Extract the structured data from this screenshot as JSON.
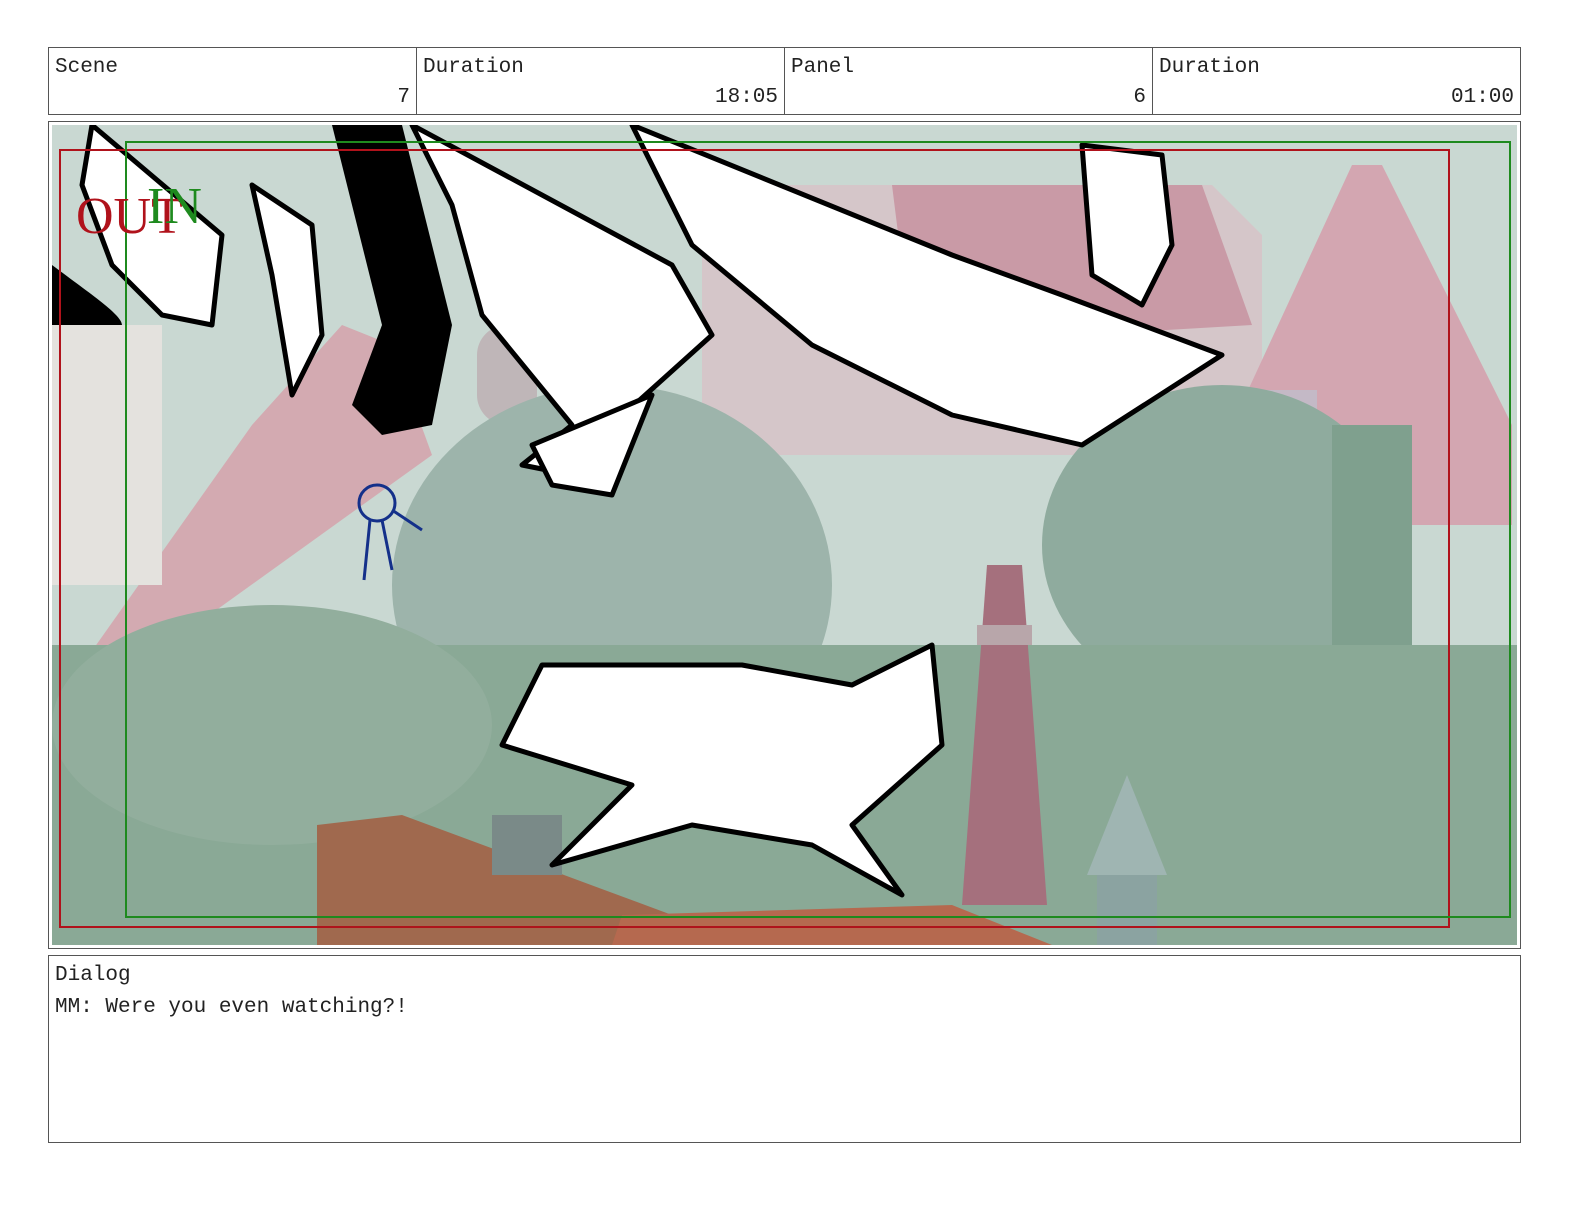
{
  "header": {
    "scene_label": "Scene",
    "scene_value": "7",
    "scene_duration_label": "Duration",
    "scene_duration_value": "18:05",
    "panel_label": "Panel",
    "panel_value": "6",
    "panel_duration_label": "Duration",
    "panel_duration_value": "01:00"
  },
  "frame": {
    "out_label": "OUT",
    "in_label": "IN",
    "out_color": "#b0121b",
    "in_color": "#1e8a1e"
  },
  "dialog": {
    "label": "Dialog",
    "text": "MM: Were you even watching?!"
  }
}
